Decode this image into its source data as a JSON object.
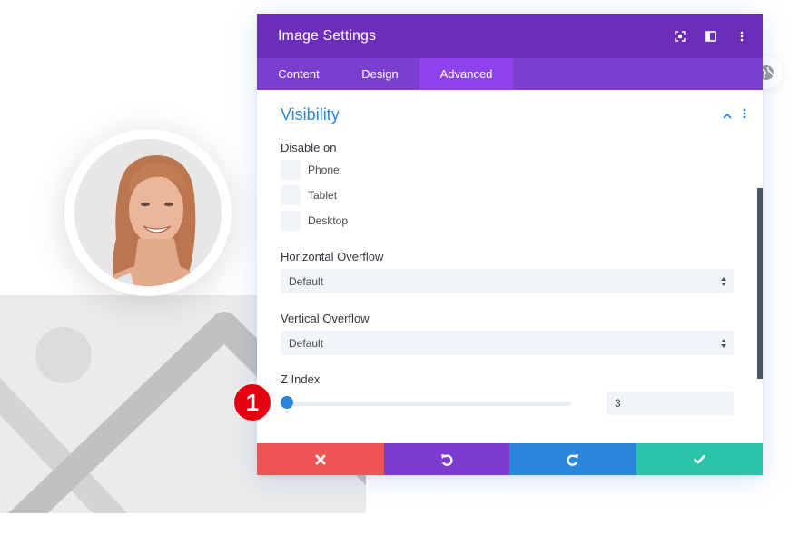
{
  "modal": {
    "title": "Image Settings",
    "header_icons": [
      "focus-mode-icon",
      "split-view-icon",
      "more-options-icon"
    ],
    "tabs": [
      {
        "label": "Content",
        "active": false
      },
      {
        "label": "Design",
        "active": false
      },
      {
        "label": "Advanced",
        "active": true
      }
    ],
    "section": {
      "title": "Visibility",
      "collapsed": false
    },
    "disable_on": {
      "label": "Disable on",
      "options": [
        {
          "label": "Phone",
          "checked": false
        },
        {
          "label": "Tablet",
          "checked": false
        },
        {
          "label": "Desktop",
          "checked": false
        }
      ]
    },
    "horizontal_overflow": {
      "label": "Horizontal Overflow",
      "value": "Default"
    },
    "vertical_overflow": {
      "label": "Vertical Overflow",
      "value": "Default"
    },
    "z_index": {
      "label": "Z Index",
      "value": "3",
      "slider_fraction": 0.0
    }
  },
  "footer": {
    "buttons": [
      "cancel",
      "undo",
      "redo",
      "save"
    ]
  },
  "annotation": {
    "marker_number": "1"
  },
  "colors": {
    "header": "#6c2eb9",
    "tabs": "#7b3fd0",
    "active_tab": "#8f42ec",
    "accent_blue": "#2b87da",
    "cancel": "#ef5555",
    "undo": "#7e3bd0",
    "redo": "#2b87da",
    "save": "#29c4a9",
    "marker": "#e3000f"
  }
}
